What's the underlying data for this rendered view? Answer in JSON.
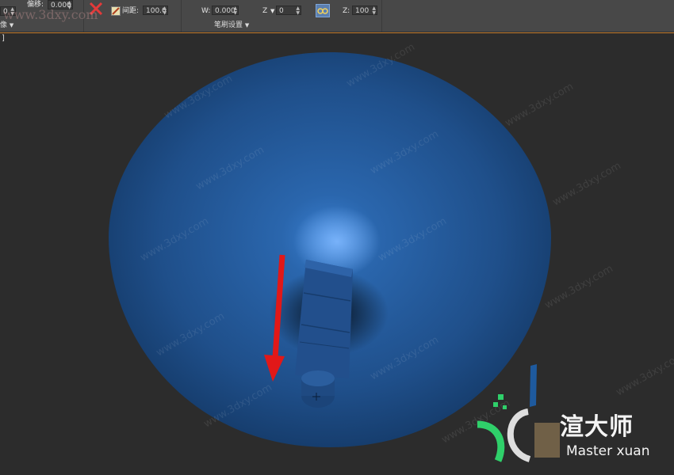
{
  "toolbar": {
    "left_spinner_value": "0",
    "offset_label": "偏移:",
    "offset_value": "0.000",
    "spacing_label": "间距:",
    "spacing_value": "100.0",
    "w_label": "W:",
    "w_value": "0.000",
    "z_axis_label": "Z",
    "z_axis_value": "0",
    "z_label": "Z:",
    "z_value": "100",
    "left_section_label": "像",
    "brush_settings_label": "笔刷设置"
  },
  "viewport": {
    "label": "]"
  },
  "watermark": {
    "top_left": "www.3dxy.com",
    "repeated": "www.3dxy.com",
    "brand_cn": "渲大师",
    "brand_en": "Master xuan"
  },
  "colors": {
    "toolbar_bg": "#484848",
    "viewport_bg": "#2c2c2c",
    "sphere_blue": "#1f4f8a",
    "arrow_red": "#e11818",
    "accent_orange": "#c47a2a",
    "logo_green": "#2fd06a"
  }
}
